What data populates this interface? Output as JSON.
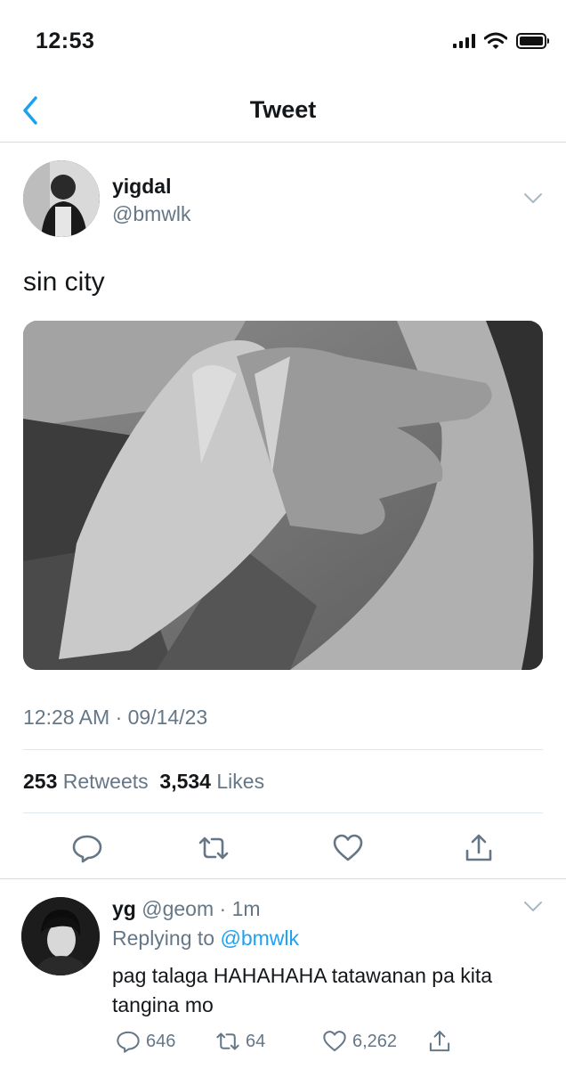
{
  "status_bar": {
    "time": "12:53"
  },
  "nav": {
    "title": "Tweet"
  },
  "tweet": {
    "author_name": "yigdal",
    "author_handle": "@bmwlk",
    "text": "sin city",
    "timestamp": "12:28 AM · 09/14/23",
    "retweets_count": "253",
    "retweets_label": "Retweets",
    "likes_count": "3,534",
    "likes_label": "Likes"
  },
  "reply": {
    "name": "yg",
    "handle": "@geom",
    "time_separator": " · ",
    "time": "1m",
    "replying_prefix": "Replying to ",
    "replying_to": "@bmwlk",
    "text": "pag talaga HAHAHAHA tatawanan pa kita tangina mo",
    "reply_count": "646",
    "retweet_count": "64",
    "like_count": "6,262"
  },
  "colors": {
    "accent": "#1da1f2",
    "muted": "#657786",
    "divider": "#e1e8ed",
    "icon": "#657786"
  },
  "icons": [
    "back-chevron-icon",
    "chevron-down-icon",
    "reply-icon",
    "retweet-icon",
    "like-icon",
    "share-icon",
    "signal-icon",
    "wifi-icon",
    "battery-icon"
  ]
}
